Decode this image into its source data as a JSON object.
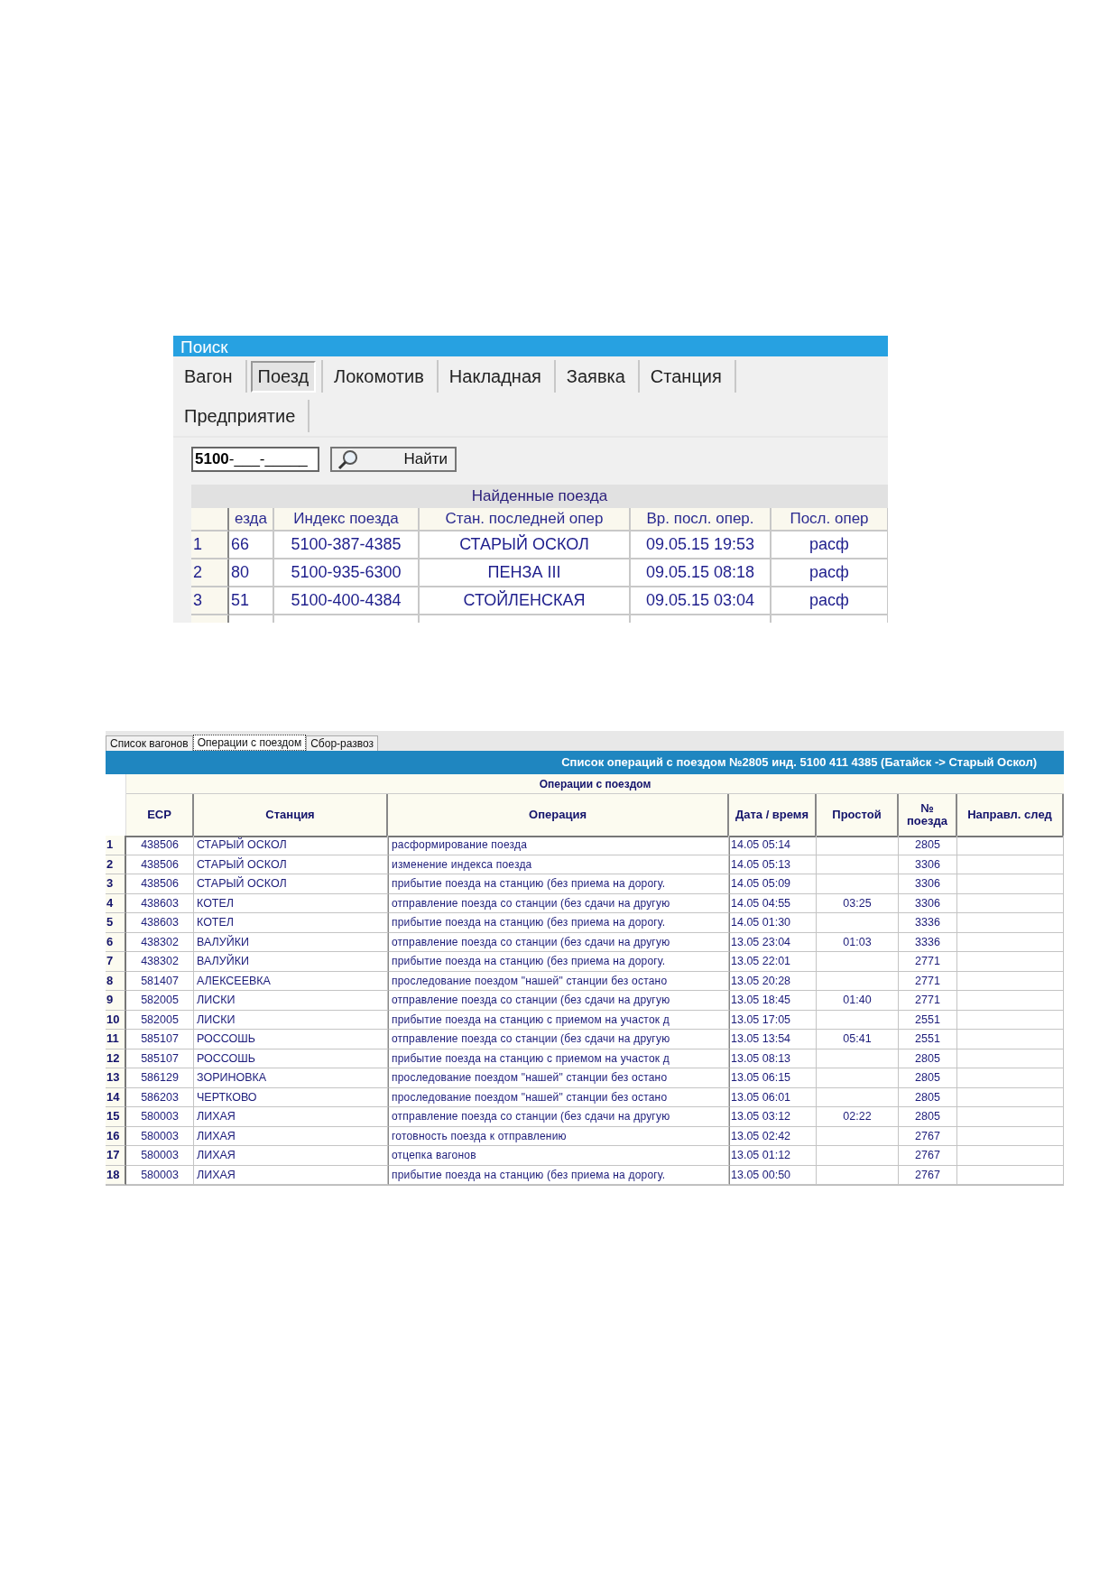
{
  "search_window": {
    "title": "Поиск",
    "tabs": [
      {
        "label": "Вагон",
        "selected": false
      },
      {
        "label": "Поезд",
        "selected": true
      },
      {
        "label": "Локомотив",
        "selected": false
      },
      {
        "label": "Накладная",
        "selected": false
      },
      {
        "label": "Заявка",
        "selected": false
      },
      {
        "label": "Станция",
        "selected": false
      },
      {
        "label": "Предприятие",
        "selected": false
      }
    ],
    "field": {
      "value": "**5100**-___-_____"
    },
    "find_button": "Найти",
    "grid": {
      "caption": "Найденные поезда",
      "columns": [
        "езда",
        "Индекс поезда",
        "Стан. последней опер",
        "Вр. посл. опер.",
        "Посл. опер"
      ],
      "rows": [
        {
          "number": "1",
          "cells": [
            "66",
            "5100-387-4385",
            "СТАРЫЙ ОСКОЛ",
            "09.05.15 19:53",
            "расф"
          ]
        },
        {
          "number": "2",
          "cells": [
            "80",
            "5100-935-6300",
            "ПЕНЗА III",
            "09.05.15 08:18",
            "расф"
          ]
        },
        {
          "number": "3",
          "cells": [
            "51",
            "5100-400-4384",
            "СТОЙЛЕНСКАЯ",
            "09.05.15 03:04",
            "расф"
          ]
        }
      ]
    }
  },
  "operations_window": {
    "tabs": [
      {
        "label": "Список вагонов",
        "selected": false
      },
      {
        "label": "Операции с поездом",
        "selected": true
      },
      {
        "label": "Сбор-развоз",
        "selected": false
      }
    ],
    "title": "Список операций с поездом №2805  инд. 5100 411 4385 (Батайск -> Старый Оскол)",
    "group_header": "Операции с поездом",
    "columns": [
      "ЕСР",
      "Станция",
      "Операция",
      "Дата / время",
      "Простой",
      "№ поезда",
      "Направл. след"
    ],
    "rows": [
      {
        "number": "1",
        "esr": "438506",
        "station": "СТАРЫЙ ОСКОЛ",
        "operation": "расформирование поезда",
        "datetime": "14.05 05:14",
        "train": "2805"
      },
      {
        "number": "2",
        "esr": "438506",
        "station": "СТАРЫЙ ОСКОЛ",
        "operation": "изменение индекса поезда",
        "datetime": "14.05 05:13",
        "train": "3306"
      },
      {
        "number": "3",
        "esr": "438506",
        "station": "СТАРЫЙ ОСКОЛ",
        "operation": "прибытие поезда на станцию (без приема на дорогу.",
        "datetime": "14.05 05:09",
        "train": "3306"
      },
      {
        "number": "4",
        "esr": "438603",
        "station": "КОТЕЛ",
        "operation": "отправление поезда со станции (без сдачи на другую",
        "datetime": "14.05 04:55",
        "idle": "03:25",
        "train": "3306"
      },
      {
        "number": "5",
        "esr": "438603",
        "station": "КОТЕЛ",
        "operation": "прибытие поезда на станцию (без приема на дорогу.",
        "datetime": "14.05 01:30",
        "train": "3336"
      },
      {
        "number": "6",
        "esr": "438302",
        "station": "ВАЛУЙКИ",
        "operation": "отправление поезда со станции (без сдачи на другую",
        "datetime": "13.05 23:04",
        "idle": "01:03",
        "train": "3336"
      },
      {
        "number": "7",
        "esr": "438302",
        "station": "ВАЛУЙКИ",
        "operation": "прибытие поезда на станцию (без приема на дорогу.",
        "datetime": "13.05 22:01",
        "train": "2771"
      },
      {
        "number": "8",
        "esr": "581407",
        "station": "АЛЕКСЕЕВКА",
        "operation": "проследование поездом \"нашей\" станции без остано",
        "datetime": "13.05 20:28",
        "train": "2771"
      },
      {
        "number": "9",
        "esr": "582005",
        "station": "ЛИСКИ",
        "operation": "отправление поезда со станции (без сдачи на другую",
        "datetime": "13.05 18:45",
        "idle": "01:40",
        "train": "2771"
      },
      {
        "number": "10",
        "esr": "582005",
        "station": "ЛИСКИ",
        "operation": "прибытие поезда на станцию с приемом на участок д",
        "datetime": "13.05 17:05",
        "train": "2551"
      },
      {
        "number": "11",
        "esr": "585107",
        "station": "РОССОШЬ",
        "operation": "отправление поезда со станции (без сдачи на другую",
        "datetime": "13.05 13:54",
        "idle": "05:41",
        "train": "2551"
      },
      {
        "number": "12",
        "esr": "585107",
        "station": "РОССОШЬ",
        "operation": "прибытие поезда на станцию с приемом на участок д",
        "datetime": "13.05 08:13",
        "train": "2805"
      },
      {
        "number": "13",
        "esr": "586129",
        "station": "ЗОРИНОВКА",
        "operation": "проследование поездом \"нашей\" станции без остано",
        "datetime": "13.05 06:15",
        "train": "2805"
      },
      {
        "number": "14",
        "esr": "586203",
        "station": "ЧЕРТКОВО",
        "operation": "проследование поездом \"нашей\" станции без остано",
        "datetime": "13.05 06:01",
        "train": "2805"
      },
      {
        "number": "15",
        "esr": "580003",
        "station": "ЛИХАЯ",
        "operation": "отправление поезда со станции (без сдачи на другую",
        "datetime": "13.05 03:12",
        "idle": "02:22",
        "train": "2805"
      },
      {
        "number": "16",
        "esr": "580003",
        "station": "ЛИХАЯ",
        "operation": "готовность поезда к отправлению",
        "datetime": "13.05 02:42",
        "train": "2767"
      },
      {
        "number": "17",
        "esr": "580003",
        "station": "ЛИХАЯ",
        "operation": "отцепка вагонов",
        "datetime": "13.05 01:12",
        "train": "2767"
      },
      {
        "number": "18",
        "esr": "580003",
        "station": "ЛИХАЯ",
        "operation": "прибытие поезда на станцию (без приема на дорогу.",
        "datetime": "13.05 00:50",
        "train": "2767"
      }
    ]
  }
}
